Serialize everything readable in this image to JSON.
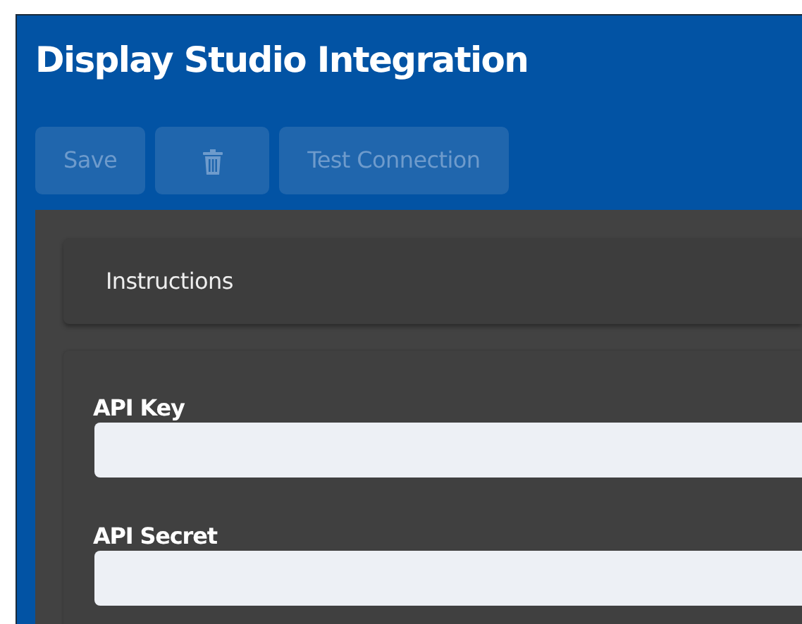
{
  "title": "Display Studio Integration",
  "toolbar": [
    {
      "kind": "text",
      "label": "Save",
      "disabled": true
    },
    {
      "kind": "trash",
      "disabled": true
    },
    {
      "kind": "text",
      "label": "Test Connection",
      "disabled": true
    }
  ],
  "instructions": {
    "label": "Instructions"
  },
  "fields": [
    {
      "label": "API Key"
    },
    {
      "label": "API Secret"
    }
  ]
}
